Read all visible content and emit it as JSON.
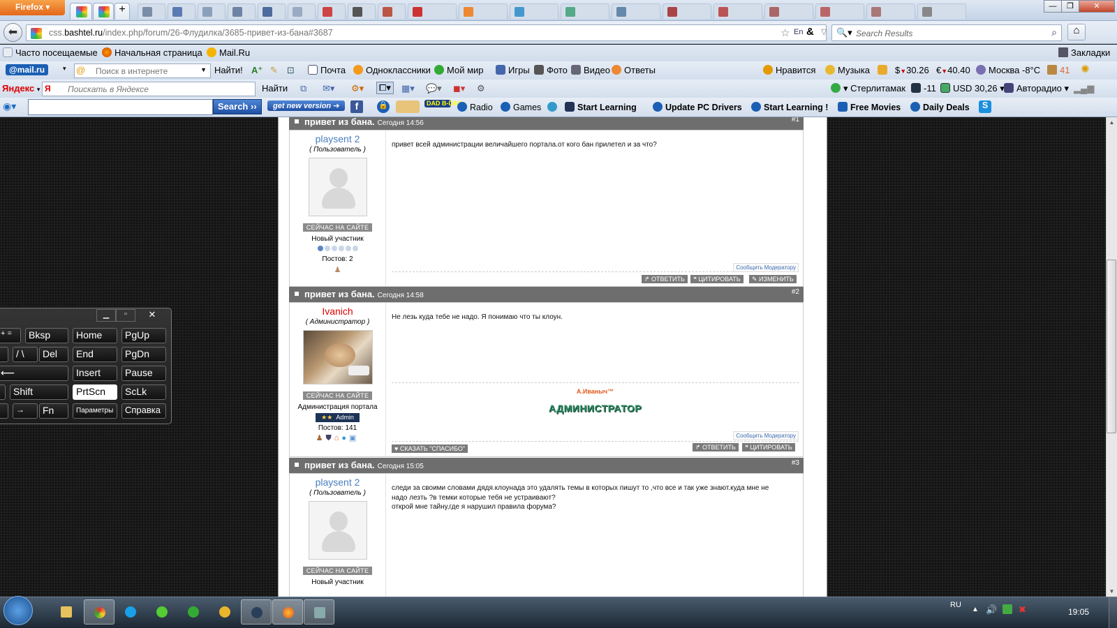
{
  "browser": {
    "app_name": "Firefox",
    "new_tab_glyph": "+",
    "win_min": "—",
    "win_max": "❐",
    "win_close": "✕",
    "url_prefix": "css.",
    "url_domain": "bashtel.ru",
    "url_path": "/index.php/forum/26-Флудилка/3685-привет-из-бана#3687",
    "search_placeholder": "Search Results",
    "bookmarks_label": "Закладки",
    "bookmarks": [
      "Часто посещаемые",
      "Начальная страница",
      "Mail.Ru"
    ]
  },
  "mail_toolbar": {
    "logo": "@mail.ru",
    "search_placeholder": "Поиск в интернете",
    "find_label": "Найти!",
    "items": [
      "Почта",
      "Одноклассники",
      "Мой мир",
      "Игры",
      "Фото",
      "Видео",
      "Ответы"
    ],
    "like": "Нравится",
    "music": "Музыка",
    "usd": "30.26",
    "eur": "40.40",
    "weather": "Москва -8°C",
    "traffic": "41"
  },
  "yandex_toolbar": {
    "logo": "Яндекс",
    "search_placeholder": "Поискать в Яндексе",
    "find_label": "Найти",
    "city": "Стерлитамак",
    "temp": "-11",
    "usd": "USD 30,26",
    "radio": "Авторадио"
  },
  "extra_toolbar": {
    "search_button": "Search",
    "new_version": "get new version",
    "items": [
      "Radio",
      "Games",
      "Start Learning",
      "Update PC Drivers",
      "Start Learning !",
      "Free Movies",
      "Daily Deals"
    ],
    "dadbday": "DAD B-DAY"
  },
  "forum": {
    "posts": [
      {
        "title": "привет из бана.",
        "date": "Сегодня 14:56",
        "num": "#1",
        "user": "playsent 2",
        "role": "( Пользователь )",
        "online": "СЕЙЧАС НА САЙТЕ",
        "group": "Новый участник",
        "posts_count": "Постов: 2",
        "text": "привет всей администрации величайшего портала.от кого бан прилетел и за что?",
        "report": "Сообщить Модератору",
        "reply": "ОТВЕТИТЬ",
        "quote": "ЦИТИРОВАТЬ",
        "edit": "ИЗМЕНИТЬ"
      },
      {
        "title": "привет из бана.",
        "date": "Сегодня 14:58",
        "num": "#2",
        "user": "Ivanich",
        "role": "( Администратор )",
        "online": "СЕЙЧАС НА САЙТЕ",
        "group": "Администрация портала",
        "badge": "Admin",
        "posts_count": "Постов: 141",
        "text": "Не лезь куда тебе не надо. Я понимаю что ты клоун.",
        "sig_name": "А.Иваныч™",
        "sig_title": "АДМИНИСТРАТОР",
        "report": "Сообщить Модератору",
        "thanks": "СКАЗАТЬ \"СПАСИБО\"",
        "reply": "ОТВЕТИТЬ",
        "quote": "ЦИТИРОВАТЬ"
      },
      {
        "title": "привет из бана.",
        "date": "Сегодня 15:05",
        "num": "#3",
        "user": "playsent 2",
        "role": "( Пользователь )",
        "online": "СЕЙЧАС НА САЙТЕ",
        "group": "Новый участник",
        "text_line1": "следи за своими словами дядя.клоунада это удалять темы в которых пишут то ,что все и так уже знают.куда мне не",
        "text_line2": "надо лезть ?в темки которые тебя не устраивают?",
        "text_line3": "открой мне тайну,где я нарушил правила форума?"
      }
    ]
  },
  "osk": {
    "keys": [
      "Bksp",
      "Home",
      "PgUp",
      "Del",
      "End",
      "PgDn",
      "Insert",
      "Pause",
      "Shift",
      "PrtScn",
      "ScLk",
      "Fn",
      "Параметры",
      "Справка"
    ]
  },
  "taskbar": {
    "lang": "RU",
    "time": "19:05"
  },
  "colors": {
    "post_header": "#6e6e6e",
    "user_link": "#4a7dc0",
    "admin_name": "#e00000",
    "page_bg": "#151515"
  }
}
